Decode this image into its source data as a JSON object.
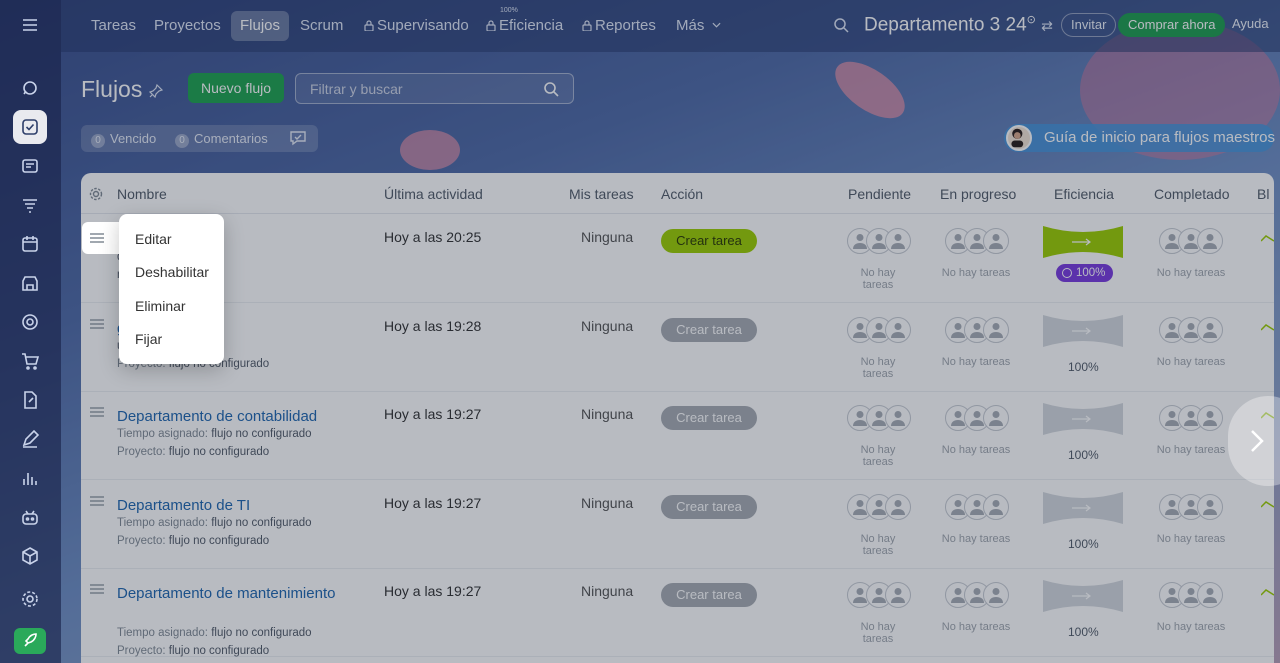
{
  "nav": {
    "tabs": [
      "Tareas",
      "Proyectos",
      "Flujos",
      "Scrum",
      "Supervisando",
      "Eficiencia",
      "Reportes",
      "Más"
    ],
    "efficiency_mini": "100%",
    "department": "Departamento 3",
    "clock": "24",
    "invite": "Invitar",
    "buy": "Comprar ahora",
    "help": "Ayuda"
  },
  "header": {
    "title": "Flujos",
    "new_flow": "Nuevo flujo",
    "filter_placeholder": "Filtrar y buscar",
    "counter_overdue_num": "0",
    "counter_overdue": "Vencido",
    "counter_comments_num": "0",
    "counter_comments": "Comentarios",
    "guide": "Guía de inicio para flujos maestros"
  },
  "table": {
    "columns": [
      "Nombre",
      "Última actividad",
      "Mis tareas",
      "Acción",
      "Pendiente",
      "En progreso",
      "Eficiencia",
      "Completado",
      "Bl"
    ],
    "rows": [
      {
        "name": "ocumentos",
        "meta1_label": "",
        "meta1_value": "días",
        "meta2_label": "",
        "meta2_value": "n de documentos",
        "activity": "Hoy a las 20:25",
        "tasks": "Ninguna",
        "action": "Crear tarea",
        "pending": "No hay tareas",
        "progress": "No hay tareas",
        "efficiency": "100%",
        "completed": "No hay tareas"
      },
      {
        "name": "gal",
        "meta1_label": "",
        "meta1_value": "ujo no configurado",
        "meta2_label": "Proyecto:",
        "meta2_value": "flujo no configurado",
        "activity": "Hoy a las 19:28",
        "tasks": "Ninguna",
        "action": "Crear tarea",
        "pending": "No hay tareas",
        "progress": "No hay tareas",
        "efficiency": "100%",
        "completed": "No hay tareas"
      },
      {
        "name": "Departamento de contabilidad",
        "meta1_label": "Tiempo asignado:",
        "meta1_value": "flujo no configurado",
        "meta2_label": "Proyecto:",
        "meta2_value": "flujo no configurado",
        "activity": "Hoy a las 19:27",
        "tasks": "Ninguna",
        "action": "Crear tarea",
        "pending": "No hay tareas",
        "progress": "No hay tareas",
        "efficiency": "100%",
        "completed": "No hay tareas"
      },
      {
        "name": "Departamento de TI",
        "meta1_label": "Tiempo asignado:",
        "meta1_value": "flujo no configurado",
        "meta2_label": "Proyecto:",
        "meta2_value": "flujo no configurado",
        "activity": "Hoy a las 19:27",
        "tasks": "Ninguna",
        "action": "Crear tarea",
        "pending": "No hay tareas",
        "progress": "No hay tareas",
        "efficiency": "100%",
        "completed": "No hay tareas"
      },
      {
        "name": "Departamento de mantenimiento",
        "meta1_label": "Tiempo asignado:",
        "meta1_value": "flujo no configurado",
        "meta2_label": "Proyecto:",
        "meta2_value": "flujo no configurado",
        "activity": "Hoy a las 19:27",
        "tasks": "Ninguna",
        "action": "Crear tarea",
        "pending": "No hay tareas",
        "progress": "No hay tareas",
        "efficiency": "100%",
        "completed": "No hay tareas"
      }
    ]
  },
  "context_menu": {
    "items": [
      "Editar",
      "Deshabilitar",
      "Eliminar",
      "Fijar"
    ]
  },
  "colors": {
    "accent_green": "#1fa44f",
    "lime_action": "#9dcf00",
    "purple_badge": "#7a3be0",
    "link_blue": "#2067b0"
  },
  "icons": [
    "menu-icon",
    "search-icon",
    "pin-icon",
    "gear-icon",
    "drag-handle-icon",
    "user-icon",
    "chevron-right-icon"
  ]
}
